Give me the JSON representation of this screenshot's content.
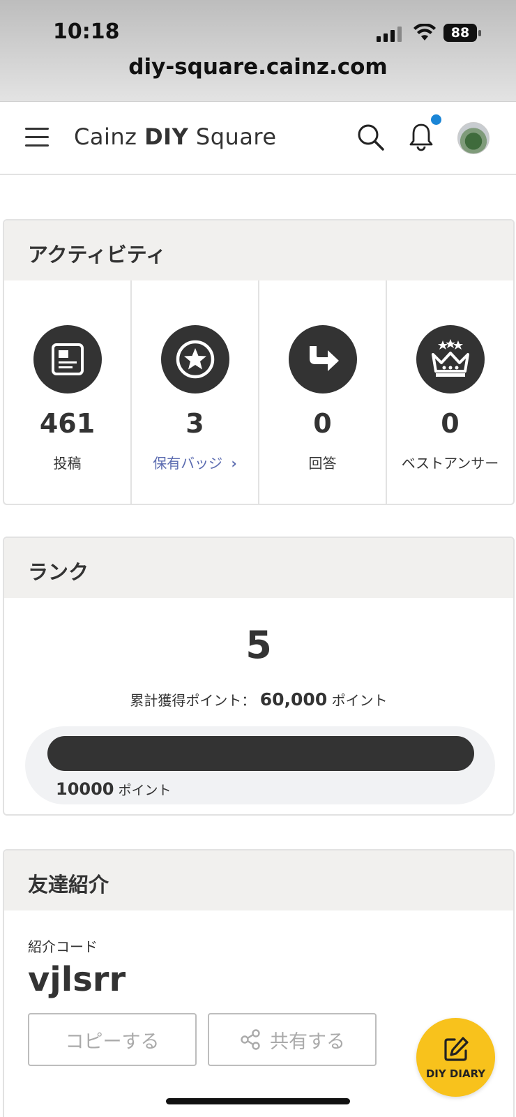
{
  "status_bar": {
    "time": "10:18",
    "battery": "88"
  },
  "browser": {
    "url": "diy-square.cainz.com"
  },
  "header": {
    "logo_regular": "Cainz ",
    "logo_bold": "DIY",
    "logo_tail": " Square"
  },
  "activity": {
    "title": "アクティビティ",
    "stats": [
      {
        "icon": "article-icon",
        "value": "461",
        "label": "投稿"
      },
      {
        "icon": "star-badge-icon",
        "value": "3",
        "label": "保有バッジ"
      },
      {
        "icon": "reply-arrow-icon",
        "value": "0",
        "label": "回答"
      },
      {
        "icon": "crown-icon",
        "value": "0",
        "label": "ベストアンサー"
      }
    ]
  },
  "rank": {
    "title": "ランク",
    "level": "5",
    "points_prefix": "累計獲得ポイント：",
    "points_value": "60,000",
    "points_suffix": "ポイント",
    "progress_value": "10000",
    "progress_suffix": "ポイント",
    "progress_fraction": 1.0
  },
  "referral": {
    "title": "友達紹介",
    "code_label": "紹介コード",
    "code": "vjlsrr",
    "copy_label": "コピーする",
    "share_label": "共有する"
  },
  "fab": {
    "label": "DIY DIARY"
  },
  "colors": {
    "accent": "#1a85d6",
    "fab": "#f8c21c",
    "link": "#5b6bb0",
    "dark": "#333333"
  }
}
